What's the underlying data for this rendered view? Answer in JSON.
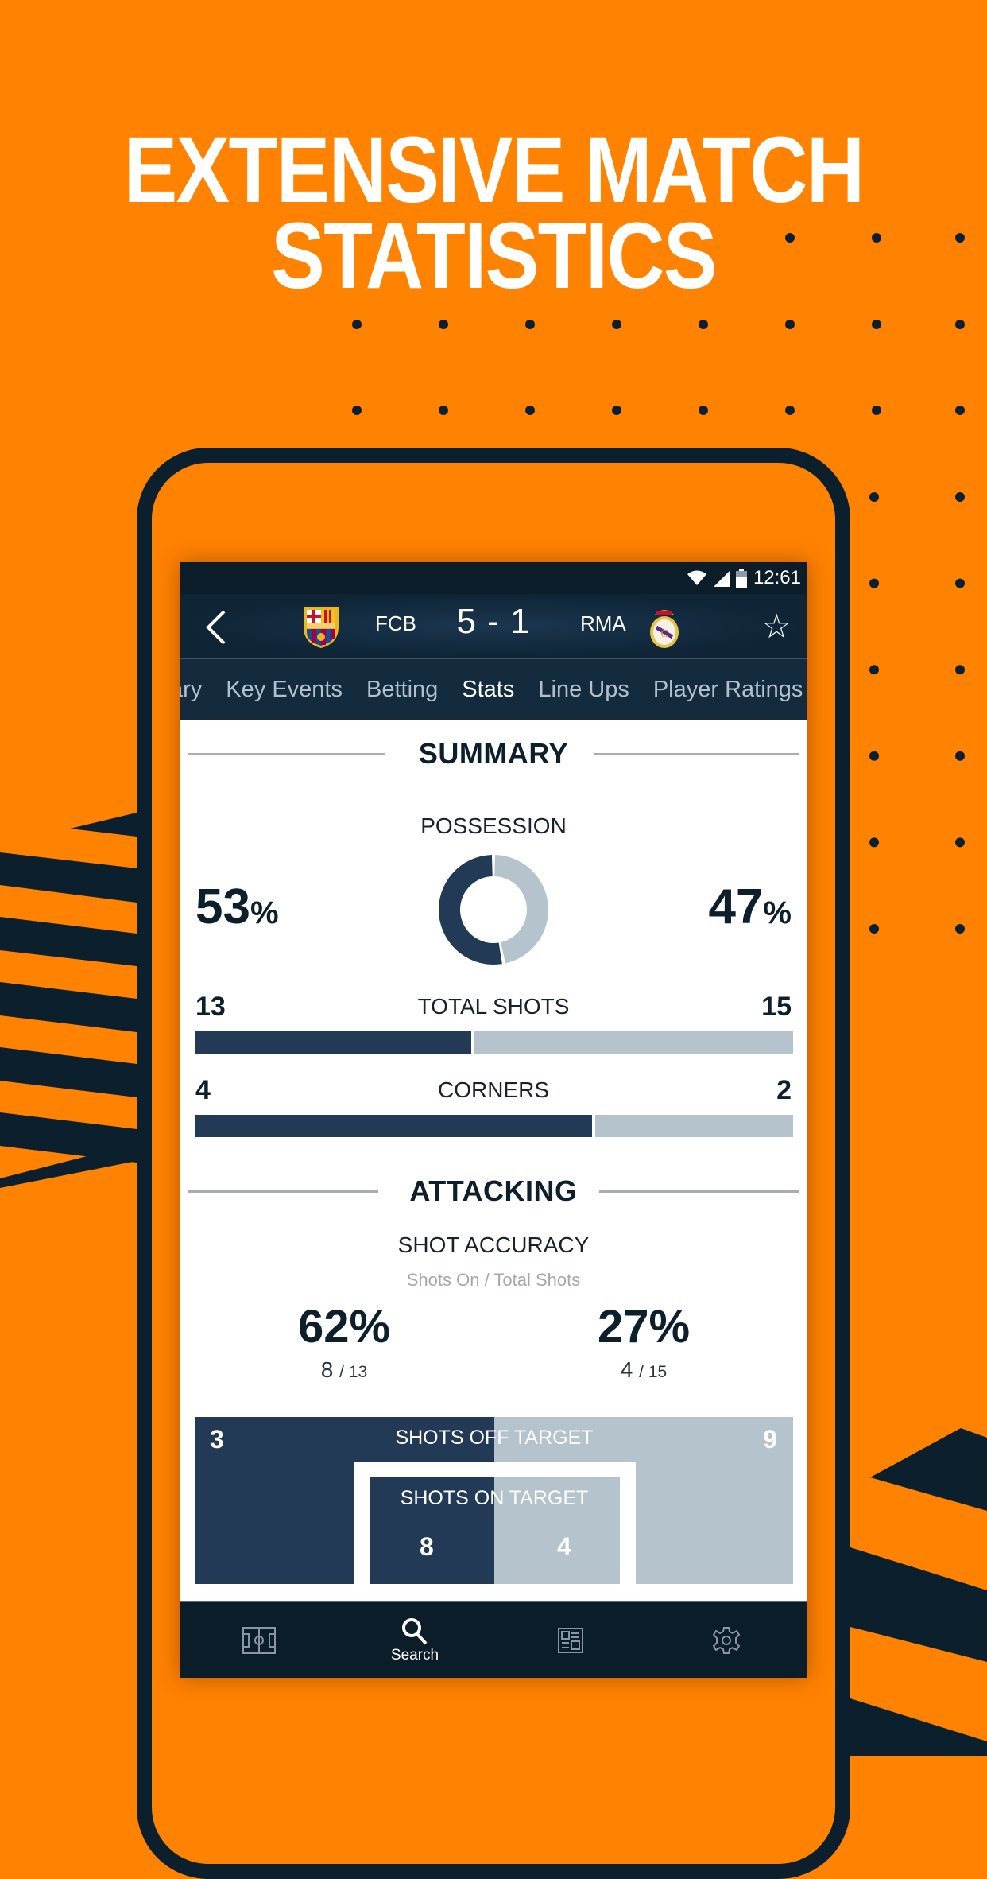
{
  "promo": {
    "headline_line1": "EXTENSIVE MATCH",
    "headline_line2": "STATISTICS",
    "background_color": "#ff8200",
    "accent_dark": "#0b1f2c"
  },
  "status_bar": {
    "time": "12:61",
    "icons": [
      "wifi-icon",
      "signal-icon",
      "battery-icon"
    ]
  },
  "match": {
    "home_team": "FCB",
    "away_team": "RMA",
    "score": "5 - 1",
    "home_crest": "fc-barcelona-crest",
    "away_crest": "real-madrid-crest"
  },
  "tabs": [
    {
      "label": "ary",
      "active": false
    },
    {
      "label": "Key Events",
      "active": false
    },
    {
      "label": "Betting",
      "active": false
    },
    {
      "label": "Stats",
      "active": true
    },
    {
      "label": "Line Ups",
      "active": false
    },
    {
      "label": "Player Ratings",
      "active": false
    }
  ],
  "summary": {
    "title": "SUMMARY",
    "possession": {
      "label": "POSSESSION",
      "home": 53,
      "away": 47,
      "home_text": "53",
      "away_text": "47",
      "unit": "%"
    },
    "total_shots": {
      "label": "TOTAL SHOTS",
      "home": 13,
      "away": 15,
      "home_text": "13",
      "away_text": "15"
    },
    "corners": {
      "label": "CORNERS",
      "home": 4,
      "away": 2,
      "home_text": "4",
      "away_text": "2"
    }
  },
  "attacking": {
    "title": "ATTACKING",
    "shot_accuracy": {
      "label": "SHOT ACCURACY",
      "sublabel": "Shots On / Total Shots",
      "home_pct": "62%",
      "away_pct": "27%",
      "home_on": "8",
      "home_total": "/ 13",
      "away_on": "4",
      "away_total": "/ 15"
    },
    "shots_off_target": {
      "label": "SHOTS OFF TARGET",
      "home": "3",
      "away": "9"
    },
    "shots_on_target": {
      "label": "SHOTS ON TARGET",
      "home": "8",
      "away": "4"
    }
  },
  "colors": {
    "home": "#223a56",
    "away": "#b4c3cc"
  },
  "bottom_nav": [
    {
      "icon": "pitch-icon",
      "label": ""
    },
    {
      "icon": "search-icon",
      "label": "Search"
    },
    {
      "icon": "news-icon",
      "label": ""
    },
    {
      "icon": "settings-gear-icon",
      "label": ""
    }
  ]
}
